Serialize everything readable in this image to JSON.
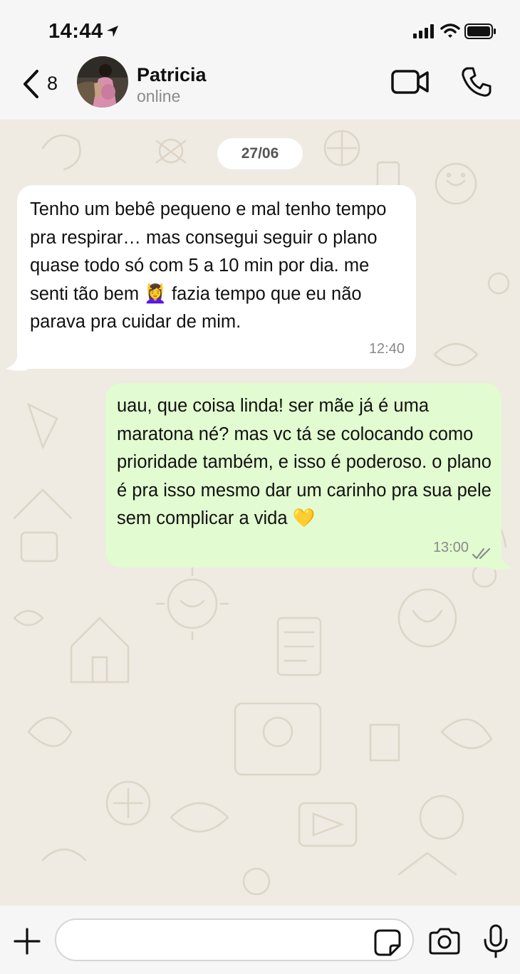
{
  "status_bar": {
    "time": "14:44"
  },
  "header": {
    "back_count": "8",
    "contact_name": "Patricia",
    "contact_status": "online"
  },
  "chat": {
    "date_chip": "27/06",
    "messages": [
      {
        "direction": "incoming",
        "text_before_emoji": "Tenho um bebê pequeno e mal tenho tempo pra respirar… mas consegui seguir o plano quase todo só com 5 a 10 min por dia. me senti tão bem ",
        "emoji": "💆‍♀️",
        "text_after_emoji": " fazia tempo que eu não parava pra cuidar de mim.",
        "time": "12:40"
      },
      {
        "direction": "outgoing",
        "text_before_emoji": "uau, que coisa linda! ser mãe já é uma maratona né? mas vc tá se colocando como prioridade também, e isso é poderoso. o plano é pra isso mesmo dar um carinho pra sua pele sem complicar a vida ",
        "emoji": "💛",
        "time": "13:00",
        "status": "read"
      }
    ]
  },
  "input": {
    "placeholder": ""
  },
  "icons": {
    "back": "chevron-left-icon",
    "video": "video-camera-icon",
    "phone": "phone-icon",
    "plus": "plus-icon",
    "sticker": "sticker-icon",
    "camera": "camera-icon",
    "mic": "microphone-icon"
  },
  "colors": {
    "incoming_bubble": "#ffffff",
    "outgoing_bubble": "#e2fbd0",
    "chat_background": "#efeae2",
    "bar_background": "#f6f6f6",
    "read_tick": "#8a8a8a"
  }
}
